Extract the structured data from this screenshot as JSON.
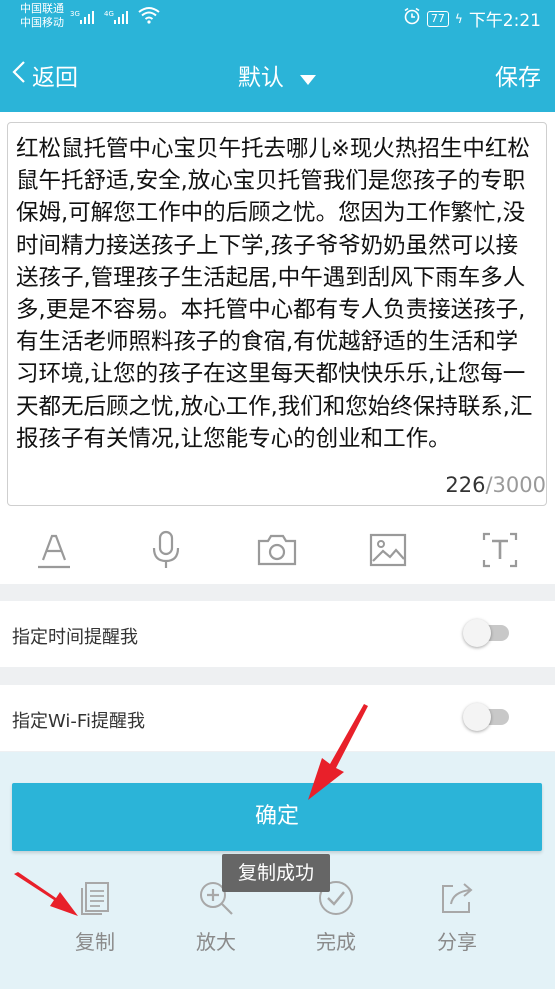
{
  "status_bar": {
    "carrier1": "中国联通",
    "carrier2": "中国移动",
    "net1": "3G",
    "net2": "4G",
    "battery": "77",
    "time": "下午2:21"
  },
  "nav": {
    "back_label": "返回",
    "title": "默认",
    "save_label": "保存"
  },
  "editor": {
    "text": "红松鼠托管中心宝贝午托去哪儿※现火热招生中红松鼠午托舒适,安全,放心宝贝托管我们是您孩子的专职保姆,可解您工作中的后顾之忧。您因为工作繁忙,没时间精力接送孩子上下学,孩子爷爷奶奶虽然可以接送孩子,管理孩子生活起居,中午遇到刮风下雨车多人多,更是不容易。本托管中心都有专人负责接送孩子,有生活老师照料孩子的食宿,有优越舒适的生活和学习环境,让您的孩子在这里每天都快快乐乐,让您每一天都无后顾之忧,放心工作,我们和您始终保持联系,汇报孩子有关情况,让您能专心的创业和工作。",
    "count": "226",
    "max": "/3000"
  },
  "toolbar_icons": [
    "text-format-icon",
    "microphone-icon",
    "camera-icon",
    "image-icon",
    "text-recognition-icon"
  ],
  "reminders": {
    "time_label": "指定时间提醒我",
    "wifi_label": "指定Wi-Fi提醒我",
    "time_on": false,
    "wifi_on": false
  },
  "confirm_label": "确定",
  "toast": "复制成功",
  "actions": {
    "copy": "复制",
    "zoom": "放大",
    "done": "完成",
    "share": "分享"
  },
  "colors": {
    "accent": "#2bb4d8",
    "arrow": "#e8202a"
  }
}
